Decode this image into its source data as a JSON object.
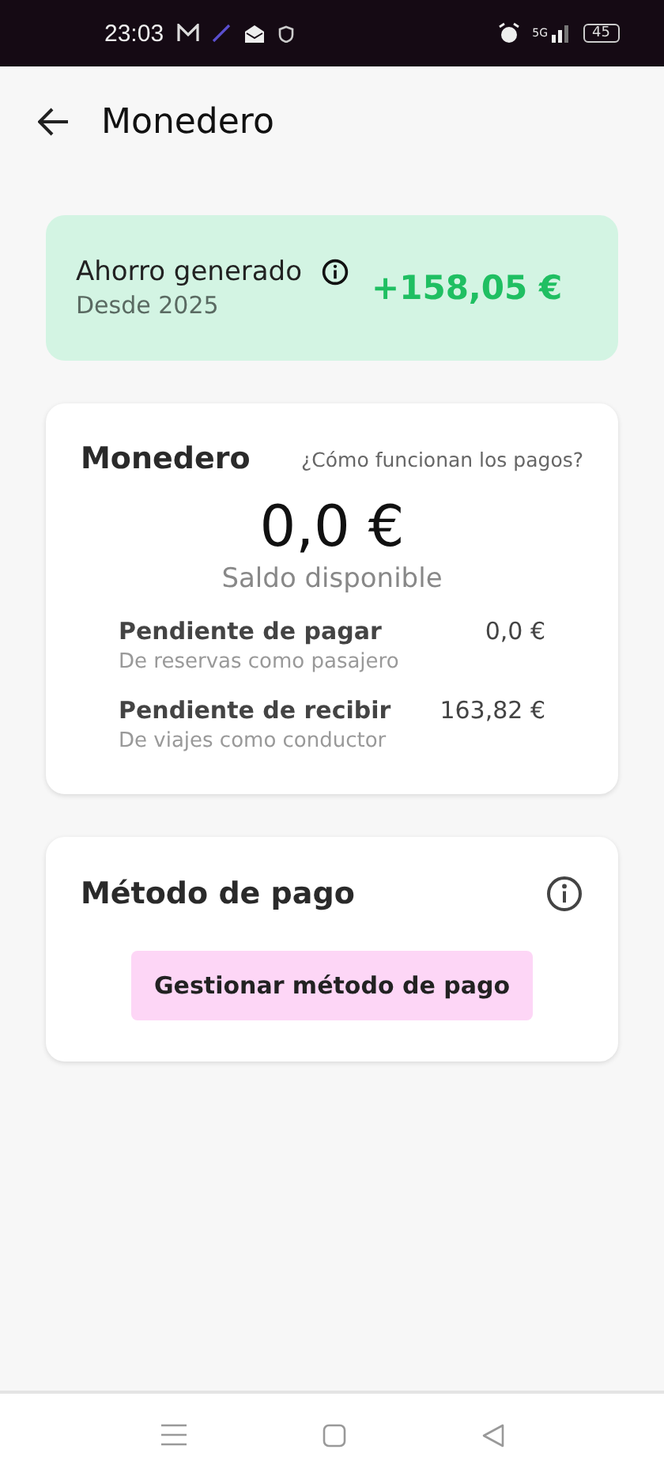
{
  "status_bar": {
    "time": "23:03",
    "network": "5G",
    "battery": "45"
  },
  "header": {
    "title": "Monedero"
  },
  "savings": {
    "label": "Ahorro generado",
    "since": "Desde 2025",
    "amount": "+158,05 €"
  },
  "wallet": {
    "title": "Monedero",
    "help_link": "¿Cómo funcionan los pagos?",
    "balance": "0,0 €",
    "balance_label": "Saldo disponible",
    "pending": [
      {
        "label": "Pendiente de pagar",
        "detail": "De reservas como pasajero",
        "amount": "0,0 €"
      },
      {
        "label": "Pendiente de recibir",
        "detail": "De viajes como conductor",
        "amount": "163,82 €"
      }
    ]
  },
  "payment": {
    "title": "Método de pago",
    "button": "Gestionar método de pago"
  }
}
